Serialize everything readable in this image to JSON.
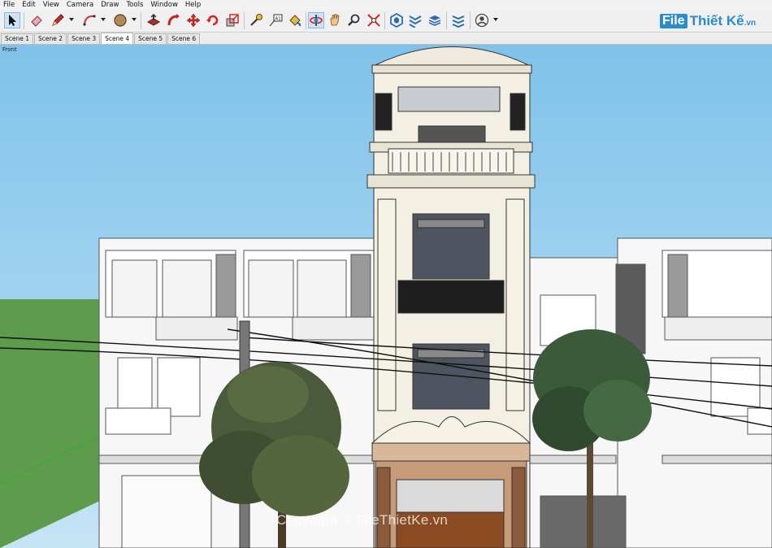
{
  "menu": [
    "File",
    "Edit",
    "View",
    "Camera",
    "Draw",
    "Tools",
    "Window",
    "Help"
  ],
  "toolbar": {
    "tools": [
      {
        "id": "select",
        "icon": "arrow-icon"
      },
      {
        "id": "eraser",
        "icon": "eraser-icon"
      },
      {
        "id": "line",
        "icon": "pencil-icon"
      },
      {
        "id": "arc",
        "icon": "arc-icon"
      },
      {
        "id": "shapes",
        "icon": "circle-icon"
      },
      {
        "id": "push-pull",
        "icon": "push-pull-icon"
      },
      {
        "id": "follow-me",
        "icon": "follow-me-icon"
      },
      {
        "id": "move",
        "icon": "move-icon"
      },
      {
        "id": "rotate",
        "icon": "rotate-icon"
      },
      {
        "id": "scale",
        "icon": "scale-icon"
      },
      {
        "id": "tape-measure",
        "icon": "tape-measure-icon"
      },
      {
        "id": "text",
        "icon": "text-icon"
      },
      {
        "id": "paint-bucket",
        "icon": "paint-bucket-icon"
      },
      {
        "id": "orbit",
        "icon": "orbit-icon"
      },
      {
        "id": "pan",
        "icon": "hand-icon"
      },
      {
        "id": "zoom",
        "icon": "zoom-icon"
      },
      {
        "id": "zoom-extents",
        "icon": "zoom-extents-icon"
      },
      {
        "id": "warehouse",
        "icon": "warehouse-icon"
      },
      {
        "id": "extensions",
        "icon": "extensions-icon"
      },
      {
        "id": "layers",
        "icon": "layers-icon"
      },
      {
        "id": "styles",
        "icon": "styles-icon"
      },
      {
        "id": "account",
        "icon": "user-icon"
      }
    ]
  },
  "logo": {
    "brand_box": "File",
    "brand_text": "Thiết Kế",
    "domain": ".vn"
  },
  "scenes": [
    "Scene 1",
    "Scene 2",
    "Scene 3",
    "Scene 4",
    "Scene 5",
    "Scene 6"
  ],
  "active_scene": "Scene 4",
  "view_label": "Front",
  "watermark": "Copyright © FileThietKe.vn",
  "colors": {
    "sky": "#86c6ec",
    "ground": "#5a9a4a",
    "facade": "#f3f0e3",
    "door": "#8a4b22",
    "ornament": "#d8b79a"
  }
}
